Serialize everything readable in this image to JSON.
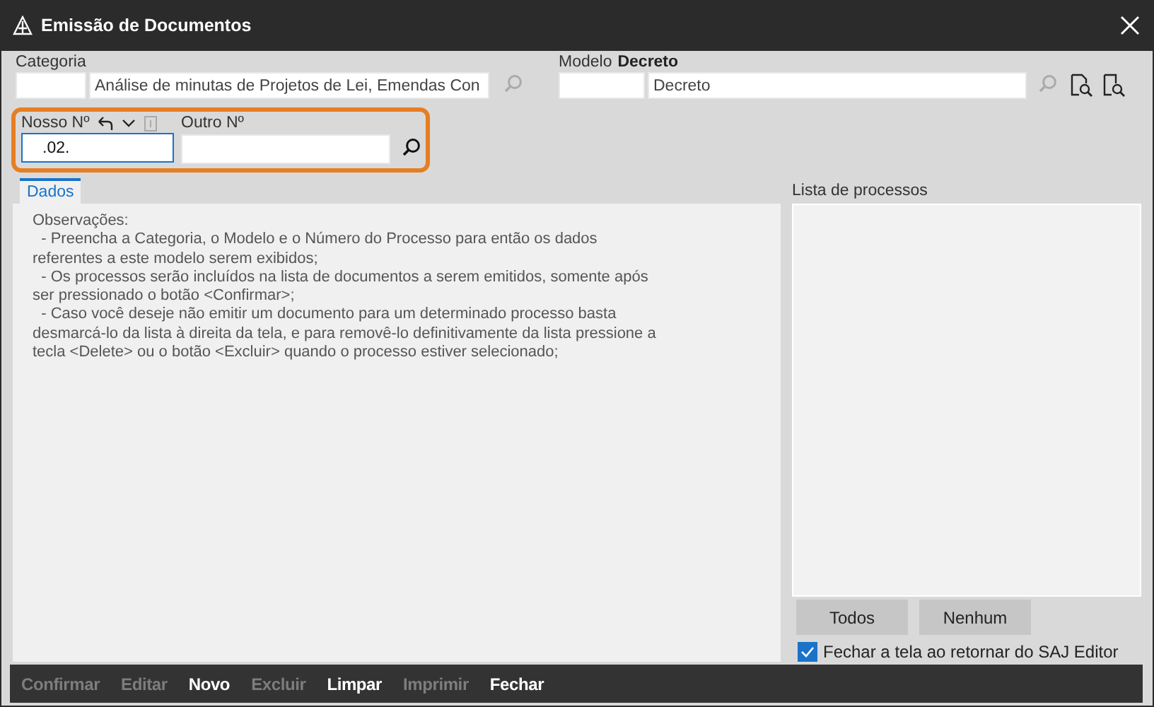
{
  "window": {
    "title": "Emissão de Documentos"
  },
  "categoria": {
    "label": "Categoria",
    "description": "Análise de minutas de Projetos de Lei, Emendas Con"
  },
  "modelo": {
    "label": "Modelo",
    "name": "Decreto",
    "description": "Decreto"
  },
  "nosso_numero": {
    "label": "Nosso Nº",
    "value": ".02.",
    "focused": true
  },
  "outro_numero": {
    "label": "Outro Nº"
  },
  "tabs": [
    {
      "label": "Dados",
      "selected": true
    }
  ],
  "observacoes": "Observações:\n  - Preencha a Categoria, o Modelo e o Número do Processo para então os dados\nreferentes a este modelo serem exibidos;\n  - Os processos serão incluídos na lista de documentos a serem emitidos, somente após\nser pressionado o botão <Confirmar>;\n  - Caso você deseje não emitir um documento para um determinado processo basta\ndesmarcá-lo da lista à direita da tela, e para removê-lo definitivamente da lista pressione a\ntecla <Delete> ou o botão <Excluir> quando o processo estiver selecionado;",
  "lista_processos": {
    "label": "Lista de processos",
    "buttons": [
      "Todos",
      "Nenhum"
    ]
  },
  "fechar_ao_retornar": {
    "label": "Fechar a tela ao retornar do SAJ Editor",
    "checked": true
  },
  "actions": [
    {
      "label": "Confirmar",
      "disabled": true
    },
    {
      "label": "Editar",
      "disabled": true
    },
    {
      "label": "Novo",
      "disabled": false
    },
    {
      "label": "Excluir",
      "disabled": true
    },
    {
      "label": "Limpar",
      "disabled": false
    },
    {
      "label": "Imprimir",
      "disabled": true
    },
    {
      "label": "Fechar",
      "disabled": false
    }
  ]
}
